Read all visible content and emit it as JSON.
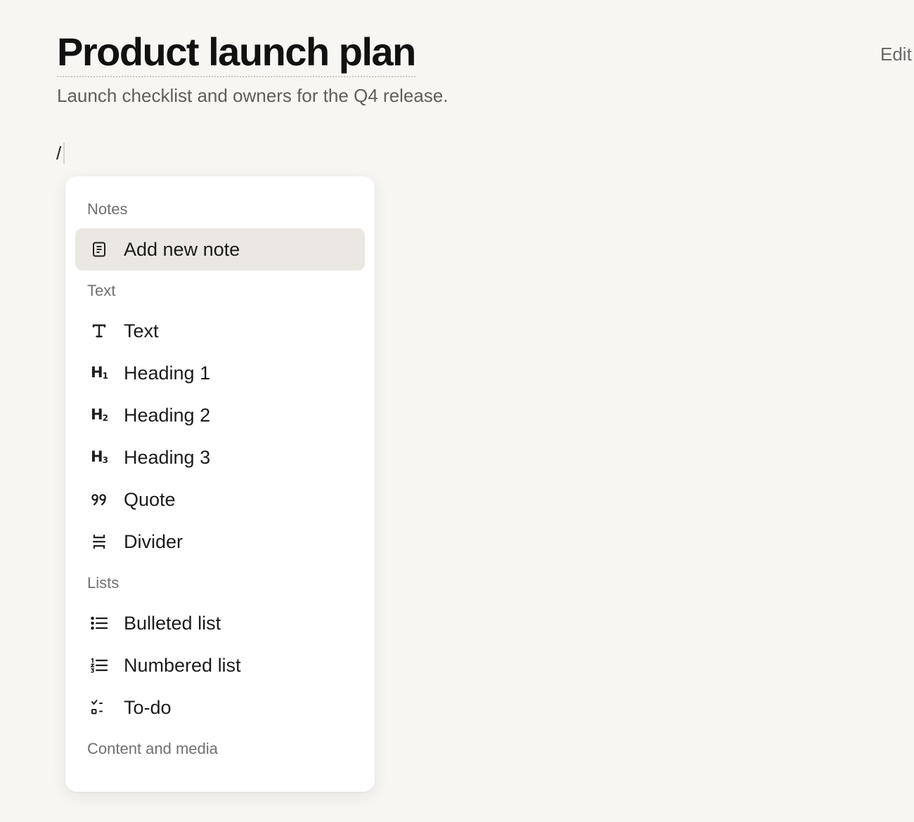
{
  "document": {
    "title": "Product launch plan",
    "subtitle": "Launch checklist and owners for the Q4 release.",
    "edit_label": "Edit",
    "editor_input": "/"
  },
  "slash_menu": {
    "sections": {
      "notes": "Notes",
      "text": "Text",
      "lists": "Lists",
      "content_media": "Content and media"
    },
    "items": {
      "add_note": {
        "label": "Add new note",
        "icon": "note-icon",
        "selected": true
      },
      "text": {
        "label": "Text",
        "icon": "text-icon"
      },
      "heading1": {
        "label": "Heading 1",
        "icon": "heading-1-icon"
      },
      "heading2": {
        "label": "Heading 2",
        "icon": "heading-2-icon"
      },
      "heading3": {
        "label": "Heading 3",
        "icon": "heading-3-icon"
      },
      "quote": {
        "label": "Quote",
        "icon": "quote-icon"
      },
      "divider": {
        "label": "Divider",
        "icon": "divider-icon"
      },
      "bulleted_list": {
        "label": "Bulleted list",
        "icon": "bulleted-list-icon"
      },
      "numbered_list": {
        "label": "Numbered list",
        "icon": "numbered-list-icon"
      },
      "todo": {
        "label": "To-do",
        "icon": "todo-icon"
      }
    }
  },
  "colors": {
    "page_background": "#f7f6f3",
    "menu_background": "#ffffff",
    "selected_item_background": "#ebe8e3",
    "section_label": "#707070"
  }
}
